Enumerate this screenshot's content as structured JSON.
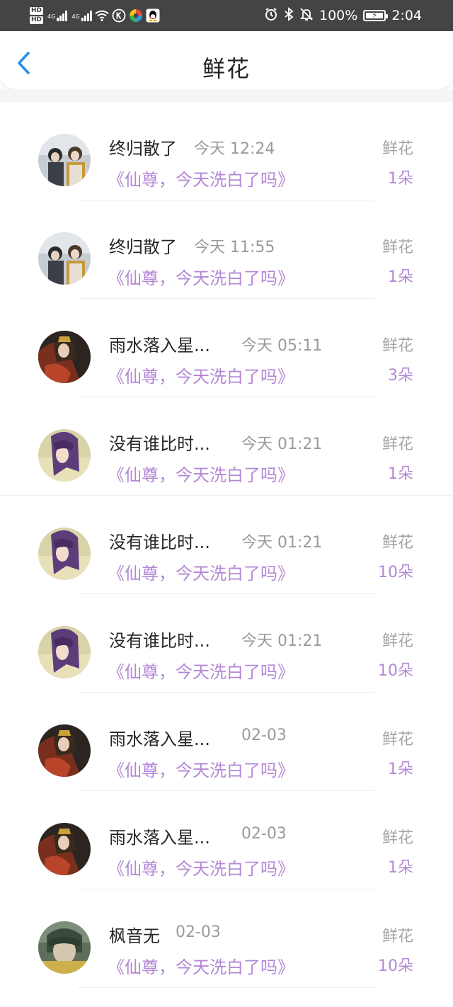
{
  "status_bar": {
    "hd1": "HD",
    "hd2": "HD",
    "net1": "4G",
    "net2": "4G",
    "battery_percent": "100%",
    "time": "2:04"
  },
  "header": {
    "title": "鲜花"
  },
  "records": [
    {
      "name": "终归散了",
      "time": "今天 12:24",
      "book": "《仙尊，今天洗白了吗》",
      "gift": "鲜花",
      "count": "1朵"
    },
    {
      "name": "终归散了",
      "time": "今天 11:55",
      "book": "《仙尊，今天洗白了吗》",
      "gift": "鲜花",
      "count": "1朵"
    },
    {
      "name": "雨水落入星...",
      "time": "今天 05:11",
      "book": "《仙尊，今天洗白了吗》",
      "gift": "鲜花",
      "count": "3朵"
    },
    {
      "name": "没有谁比时...",
      "time": "今天 01:21",
      "book": "《仙尊，今天洗白了吗》",
      "gift": "鲜花",
      "count": "1朵"
    },
    {
      "name": "没有谁比时...",
      "time": "今天 01:21",
      "book": "《仙尊，今天洗白了吗》",
      "gift": "鲜花",
      "count": "10朵"
    },
    {
      "name": "没有谁比时...",
      "time": "今天 01:21",
      "book": "《仙尊，今天洗白了吗》",
      "gift": "鲜花",
      "count": "10朵"
    },
    {
      "name": "雨水落入星...",
      "time": "02-03",
      "book": "《仙尊，今天洗白了吗》",
      "gift": "鲜花",
      "count": "1朵"
    },
    {
      "name": "雨水落入星...",
      "time": "02-03",
      "book": "《仙尊，今天洗白了吗》",
      "gift": "鲜花",
      "count": "1朵"
    },
    {
      "name": "枫音无",
      "time": "02-03",
      "book": "《仙尊，今天洗白了吗》",
      "gift": "鲜花",
      "count": "10朵"
    }
  ],
  "colors": {
    "status_bar_bg": "#444444",
    "accent_back": "#2b8fe6",
    "book_purple": "#b487d6",
    "muted_gray": "#9a9a9a"
  }
}
